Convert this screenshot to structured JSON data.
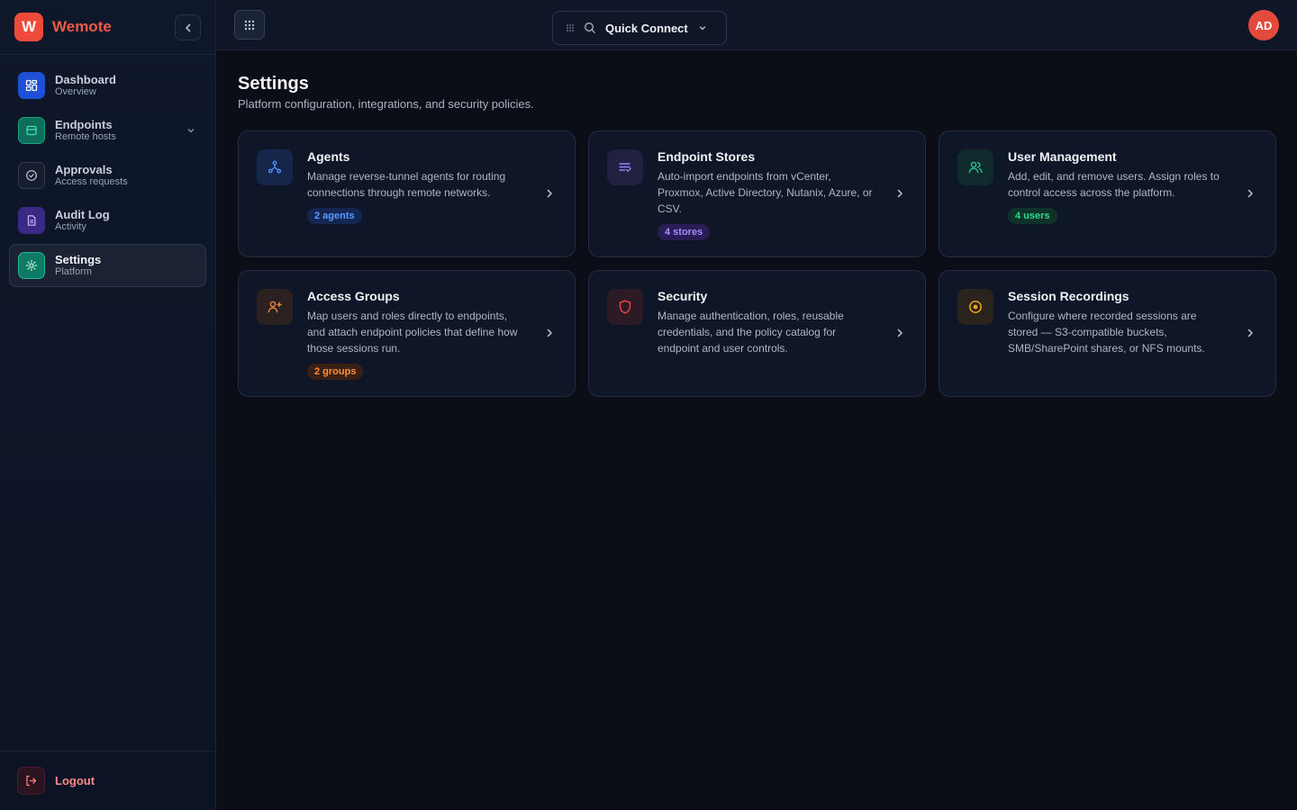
{
  "app": {
    "logo_letter": "W",
    "name": "Wemote"
  },
  "sidebar": {
    "items": [
      {
        "label": "Dashboard",
        "sub": "Overview",
        "icon": "dashboard-icon",
        "color": "#2f6bff"
      },
      {
        "label": "Endpoints",
        "sub": "Remote hosts",
        "icon": "server-icon",
        "color": "#18c29c"
      },
      {
        "label": "Approvals",
        "sub": "Access requests",
        "icon": "check-circle-icon",
        "color": "#9aa3b4"
      },
      {
        "label": "Audit Log",
        "sub": "Activity",
        "icon": "document-icon",
        "color": "#8b6cff"
      },
      {
        "label": "Settings",
        "sub": "Platform",
        "icon": "gear-icon",
        "color": "#18c29c",
        "active": true
      }
    ],
    "logout_label": "Logout"
  },
  "topbar": {
    "quick_connect_label": "Quick Connect",
    "avatar_initials": "AD"
  },
  "page": {
    "title": "Settings",
    "subtitle": "Platform configuration, integrations, and security policies."
  },
  "cards": [
    {
      "title": "Agents",
      "desc": "Manage reverse-tunnel agents for routing connections through remote networks.",
      "badge": "2 agents",
      "accent": "#3b82f6",
      "icon": "agents-icon"
    },
    {
      "title": "Endpoint Stores",
      "desc": "Auto-import endpoints from vCenter, Proxmox, Active Directory, Nutanix, Azure, or CSV.",
      "badge": "4 stores",
      "accent": "#8b5cf6",
      "icon": "list-import-icon"
    },
    {
      "title": "User Management",
      "desc": "Add, edit, and remove users. Assign roles to control access across the platform.",
      "badge": "4 users",
      "accent": "#10b981",
      "icon": "users-icon"
    },
    {
      "title": "Access Groups",
      "desc": "Map users and roles directly to endpoints, and attach endpoint policies that define how those sessions run.",
      "badge": "2 groups",
      "accent": "#f97316",
      "icon": "user-plus-icon"
    },
    {
      "title": "Security",
      "desc": "Manage authentication, roles, reusable credentials, and the policy catalog for endpoint and user controls.",
      "badge": "",
      "accent": "#ef4444",
      "icon": "shield-icon"
    },
    {
      "title": "Session Recordings",
      "desc": "Configure where recorded sessions are stored — S3-compatible buckets, SMB/SharePoint shares, or NFS mounts.",
      "badge": "",
      "accent": "#f59e0b",
      "icon": "record-icon"
    }
  ]
}
